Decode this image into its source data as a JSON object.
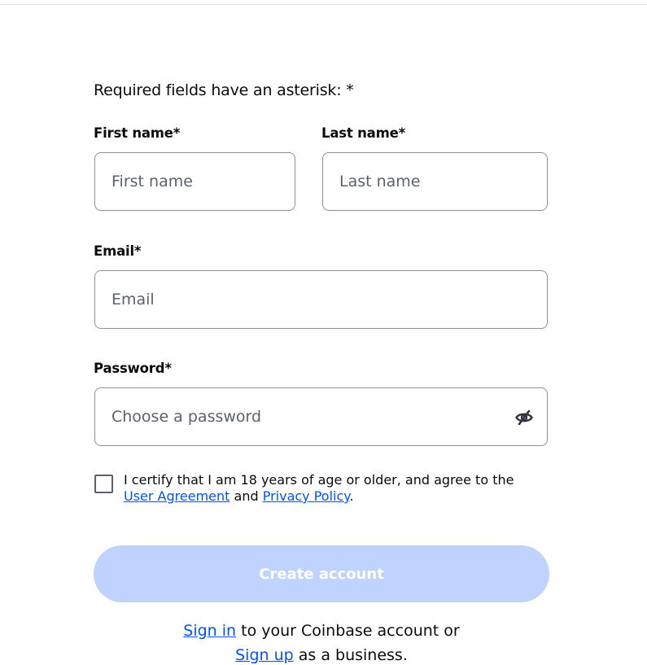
{
  "form": {
    "required_note": "Required fields have an asterisk: *",
    "first_name": {
      "label": "First name*",
      "placeholder": "First name",
      "value": ""
    },
    "last_name": {
      "label": "Last name*",
      "placeholder": "Last name",
      "value": ""
    },
    "email": {
      "label": "Email*",
      "placeholder": "Email",
      "value": ""
    },
    "password": {
      "label": "Password*",
      "placeholder": "Choose a password",
      "value": "",
      "toggle_icon": "eye-slash-icon"
    },
    "certify": {
      "checked": false,
      "text_before": "I certify that I am 18 years of age or older, and agree to the ",
      "user_agreement_link": "User Agreement",
      "text_and": " and ",
      "privacy_policy_link": "Privacy Policy",
      "text_end": "."
    },
    "create_account_label": "Create account",
    "create_account_disabled": true
  },
  "footer": {
    "sign_in_link": "Sign in",
    "sign_in_text": " to your Coinbase account or",
    "sign_up_link": "Sign up",
    "sign_up_text": " as a business."
  },
  "colors": {
    "link": "#0052ff",
    "button_disabled_bg": "#bfd3fe",
    "border": "#8a919e",
    "placeholder": "#5b616e"
  }
}
